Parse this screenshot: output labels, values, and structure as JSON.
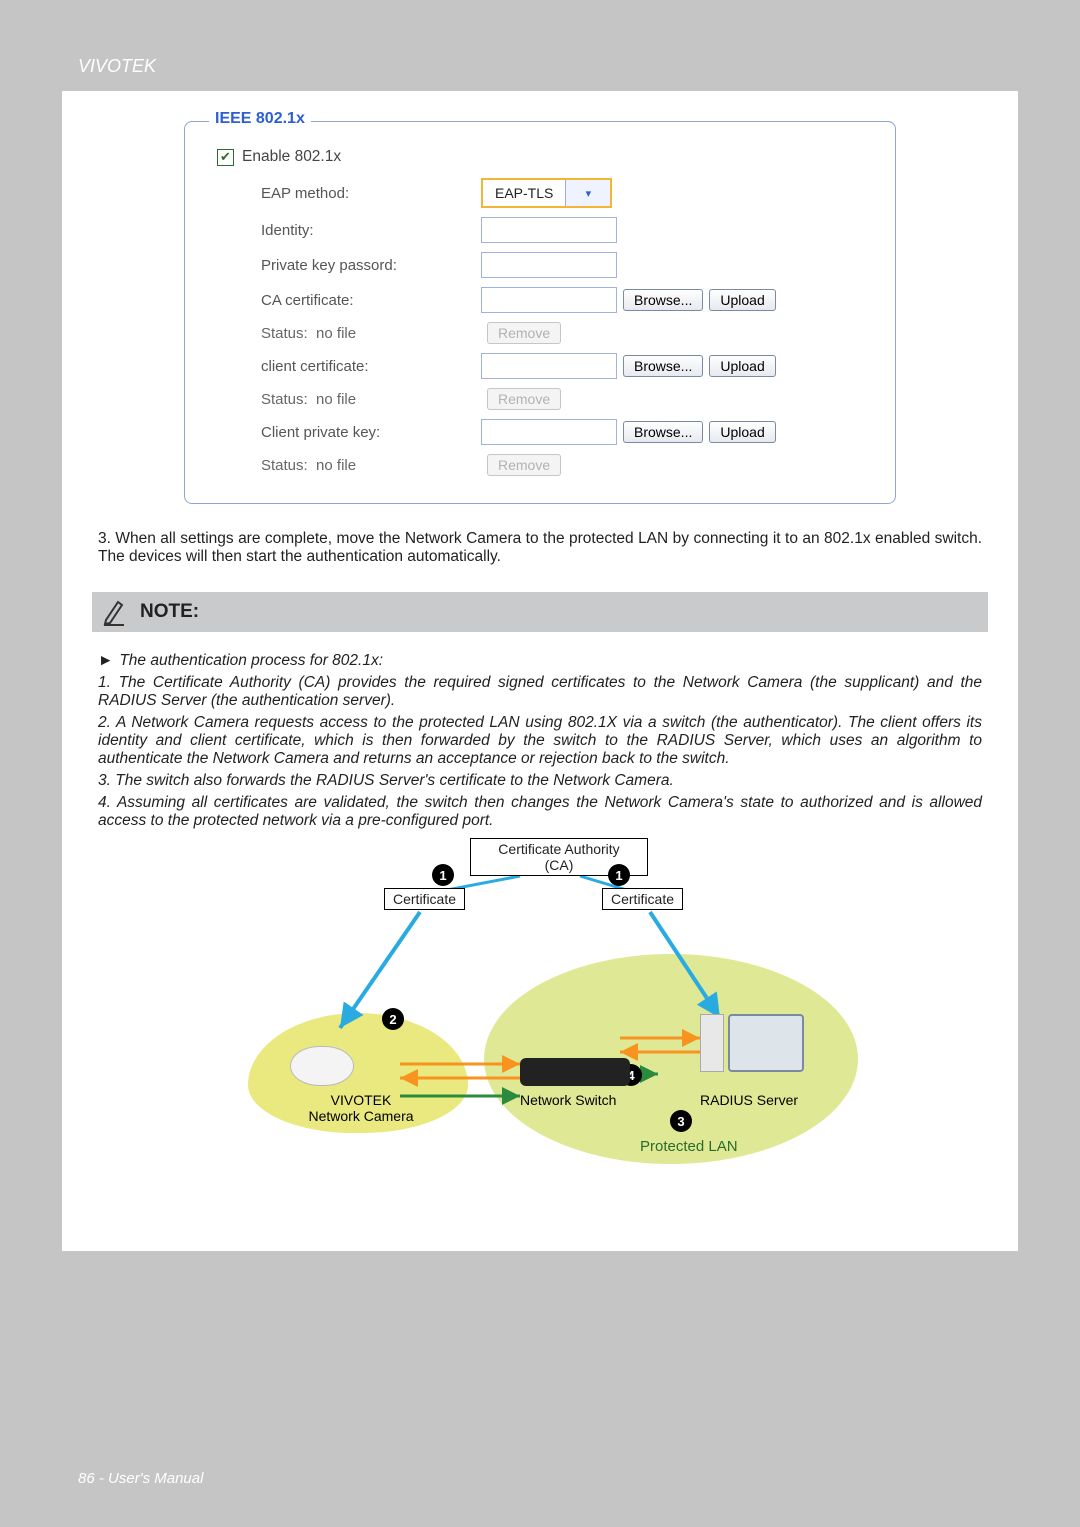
{
  "header": {
    "brand": "VIVOTEK"
  },
  "fieldset": {
    "legend": "IEEE 802.1x",
    "enable_label": "Enable 802.1x",
    "enable_checked": true,
    "eap_method_label": "EAP method:",
    "eap_method_value": "EAP-TLS",
    "identity_label": "Identity:",
    "identity_value": "",
    "pk_pass_label": "Private key passord:",
    "pk_pass_value": "",
    "ca_label": "CA certificate:",
    "client_cert_label": "client certificate:",
    "client_key_label": "Client private key:",
    "status_label": "Status:",
    "status_value": "no file",
    "browse": "Browse...",
    "upload": "Upload",
    "remove": "Remove"
  },
  "body": {
    "step3": "3. When all settings are complete, move the Network Camera to the protected LAN by connecting it to an 802.1x enabled switch. The devices will then start the authentication automatically."
  },
  "note": {
    "title": "NOTE:",
    "intro": "The authentication process for 802.1x:",
    "p1": "1. The Certificate Authority (CA) provides the required signed certificates to the Network Camera (the supplicant) and the RADIUS Server (the authentication server).",
    "p2": "2. A Network Camera requests access to the protected LAN using 802.1X via a switch (the authenticator). The client offers its identity and client certificate, which is then forwarded by the switch to the RADIUS Server, which uses an algorithm to authenticate the Network Camera and returns an acceptance or rejection back to the switch.",
    "p3": "3. The switch also forwards the RADIUS Server's certificate to the Network Camera.",
    "p4": "4. Assuming all certificates are validated, the switch then changes the Network Camera's state to authorized and is allowed access to the protected network via a pre-configured port."
  },
  "diagram": {
    "ca": "Certificate Authority\n(CA)",
    "cert": "Certificate",
    "camera_line1": "VIVOTEK",
    "camera_line2": "Network Camera",
    "switch": "Network Switch",
    "radius": "RADIUS Server",
    "protected": "Protected LAN",
    "n1": "1",
    "n2": "2",
    "n3": "3",
    "n4": "4"
  },
  "footer": {
    "page": "86",
    "sep": " - ",
    "title": "User's Manual"
  }
}
